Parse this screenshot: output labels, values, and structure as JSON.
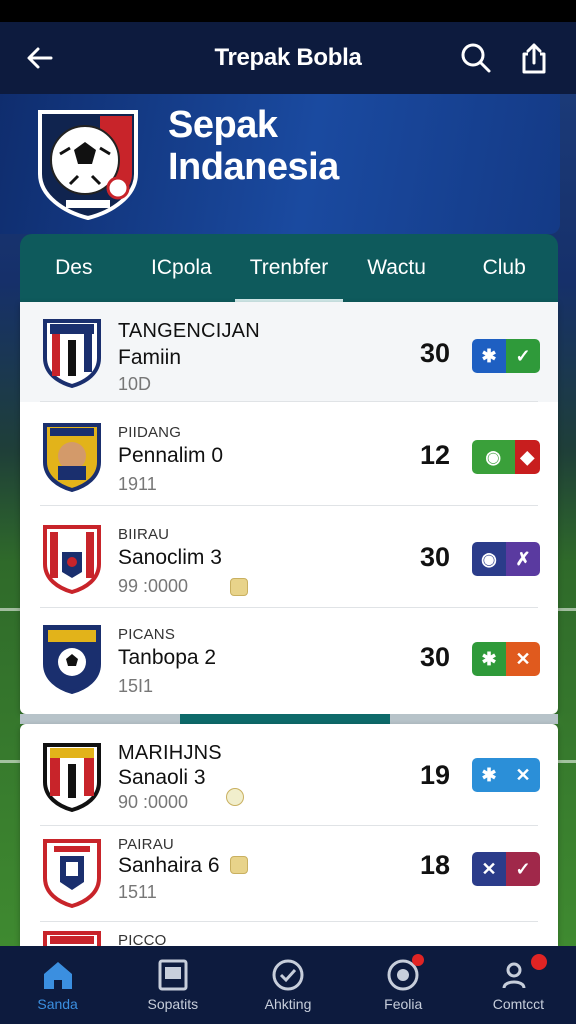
{
  "appbar": {
    "title": "Trepak Bobla"
  },
  "hero": {
    "line1": "Sepak",
    "line2": "Indanesia"
  },
  "tabs": [
    {
      "label": "Des",
      "active": false
    },
    {
      "label": "ICpola",
      "active": false
    },
    {
      "label": "Trenbfer",
      "active": true
    },
    {
      "label": "Wactu",
      "active": false
    },
    {
      "label": "Club",
      "active": false
    }
  ],
  "rows": [
    {
      "label": "TANGENCIJAN",
      "club": "Famiin",
      "meta": "10D",
      "score": "30",
      "badge": [
        "✱",
        "✓"
      ],
      "badge_colors": [
        "#1e5fc2",
        "#2f9a3a"
      ]
    },
    {
      "label": "PIIDANG",
      "club": "Pennalim 0",
      "meta": "1911",
      "score": "12",
      "badge": [
        "◉",
        "◆"
      ],
      "badge_colors": [
        "#3aa03a",
        "#c81e1e"
      ]
    },
    {
      "label": "BIIRAU",
      "club": "Sanoclim 3",
      "meta": "99 :0000",
      "score": "30",
      "badge": [
        "◉",
        "✗"
      ],
      "badge_colors": [
        "#2b3c8a",
        "#5a3aa0"
      ]
    },
    {
      "label": "PICANS",
      "club": "Tanbopa 2",
      "meta": "15I1",
      "score": "30",
      "badge": [
        "✱",
        "✕"
      ],
      "badge_colors": [
        "#2f9a3a",
        "#e05a1e"
      ]
    },
    {
      "label": "MARIHJNS",
      "club": "Sanaoli 3",
      "meta": "90 :0000",
      "score": "19",
      "badge": [
        "✱",
        "✕"
      ],
      "badge_colors": [
        "#2b8fd8",
        "#2b8fd8"
      ]
    },
    {
      "label": "PAIRAU",
      "club": "Sanhaira 6",
      "meta": "1511",
      "score": "18",
      "badge": [
        "✕",
        "✓"
      ],
      "badge_colors": [
        "#2b3c8a",
        "#a0284a"
      ]
    },
    {
      "label": "PICCO",
      "club": "",
      "meta": "",
      "score": "",
      "badge": [],
      "badge_colors": []
    }
  ],
  "nav": [
    {
      "label": "Sanda",
      "icon": "home-icon",
      "active": true
    },
    {
      "label": "Sopatits",
      "icon": "document-icon",
      "active": false
    },
    {
      "label": "Ahkting",
      "icon": "check-circle-icon",
      "active": false
    },
    {
      "label": "Feolia",
      "icon": "record-icon",
      "active": false
    },
    {
      "label": "Comtcct",
      "icon": "contacts-icon",
      "active": false
    }
  ],
  "colors": {
    "appbar": "#0d1b3e",
    "tabs": "#0e5a5c",
    "accent": "#3b8fe0",
    "notification": "#e02424"
  }
}
